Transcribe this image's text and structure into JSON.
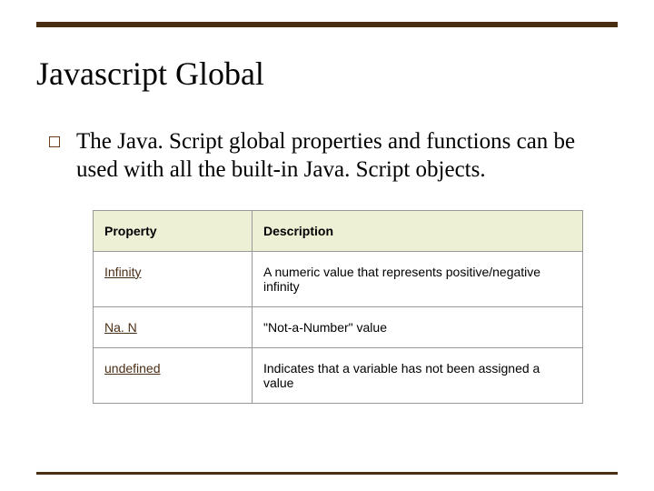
{
  "title": "Javascript Global",
  "bullet": "The Java. Script global properties and functions can be used with all the built-in Java. Script objects.",
  "table": {
    "headers": {
      "property": "Property",
      "description": "Description"
    },
    "rows": [
      {
        "property": "Infinity",
        "description": "A numeric value that represents positive/negative infinity"
      },
      {
        "property": "Na. N",
        "description": "\"Not-a-Number\" value"
      },
      {
        "property": "undefined",
        "description": "Indicates that a variable has not been assigned a value"
      }
    ]
  }
}
